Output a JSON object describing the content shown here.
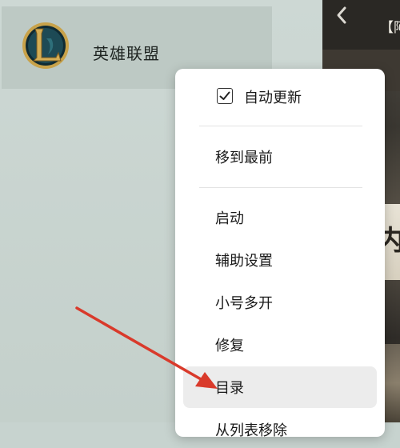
{
  "sidebar": {
    "game": {
      "name": "英雄联盟",
      "logo_icon": "league-of-legends-logo"
    }
  },
  "right_panel": {
    "back_icon": "chevron-left-icon",
    "title_fragment": "【阿",
    "card_fragment": "内"
  },
  "menu": {
    "auto_update": {
      "label": "自动更新",
      "checked": true
    },
    "move_to_front": "移到最前",
    "launch": "启动",
    "helper_settings": "辅助设置",
    "alt_account": "小号多开",
    "repair": "修复",
    "directory": "目录",
    "partial_next": "从列表移除"
  },
  "colors": {
    "arrow": "#d93a2b",
    "hover": "#ececec"
  }
}
